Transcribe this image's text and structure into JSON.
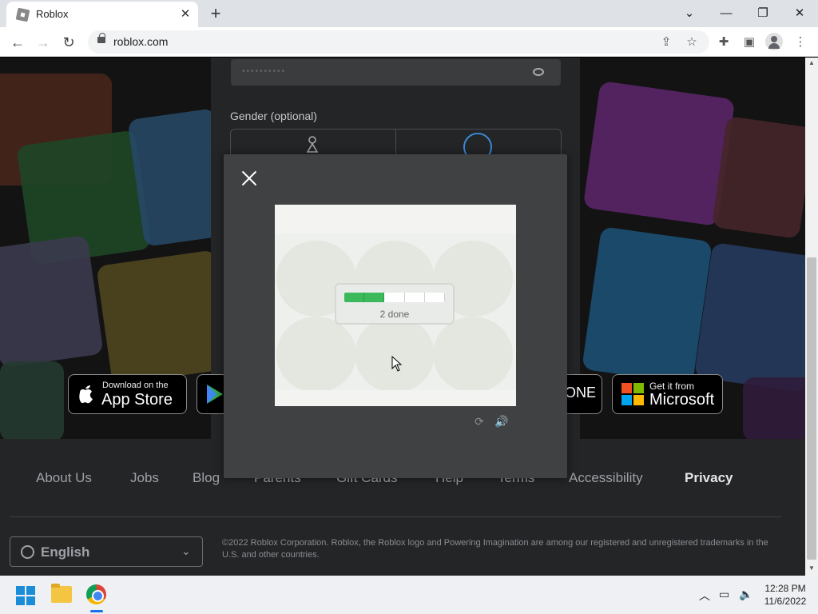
{
  "browser": {
    "tab_title": "Roblox",
    "tab_close": "✕",
    "new_tab": "+",
    "url": "roblox.com",
    "window_controls": {
      "dropdown": "⌄",
      "minimize": "—",
      "restore": "❐",
      "close": "✕"
    }
  },
  "form": {
    "password_placeholder": "••••••••••",
    "gender_label": "Gender (optional)"
  },
  "stores": {
    "appstore_small": "Download on the",
    "appstore_big": "App Store",
    "xbox_partial": "ONE",
    "microsoft_small": "Get it from",
    "microsoft_big": "Microsoft"
  },
  "footer": {
    "links": [
      "About Us",
      "Jobs",
      "Blog",
      "Parents",
      "Gift Cards",
      "Help",
      "Terms",
      "Accessibility",
      "Privacy"
    ],
    "language": "English",
    "copyright": "©2022 Roblox Corporation. Roblox, the Roblox logo and Powering Imagination are among our registered and unregistered trademarks in the U.S. and other countries."
  },
  "captcha": {
    "progress_label": "2 done",
    "progress_segments": 5,
    "progress_done": 2
  },
  "taskbar": {
    "time": "12:28 PM",
    "date": "11/6/2022"
  },
  "colors": {
    "page_bg": "#232527",
    "modal_bg": "#404143",
    "progress_green": "#3cb95b",
    "footer_text": "#9ea1a6"
  }
}
